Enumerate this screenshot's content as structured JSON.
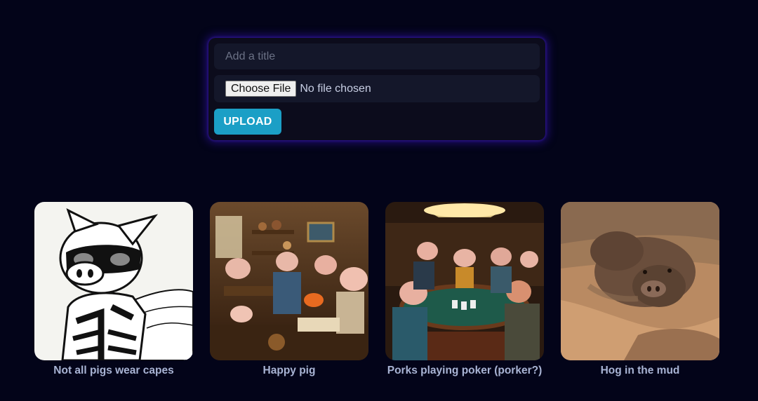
{
  "upload_form": {
    "title_placeholder": "Add a title",
    "choose_file_label": "Choose File",
    "file_status": "No file chosen",
    "upload_label": "UPLOAD"
  },
  "gallery": [
    {
      "caption": "Not all pigs wear capes"
    },
    {
      "caption": "Happy pig"
    },
    {
      "caption": "Porks playing poker (porker?)"
    },
    {
      "caption": "Hog in the mud"
    }
  ],
  "colors": {
    "background": "#030419",
    "card": "#0c0c1c",
    "input": "#14172a",
    "accent": "#1b9fc6",
    "caption": "#a9b4d4"
  }
}
